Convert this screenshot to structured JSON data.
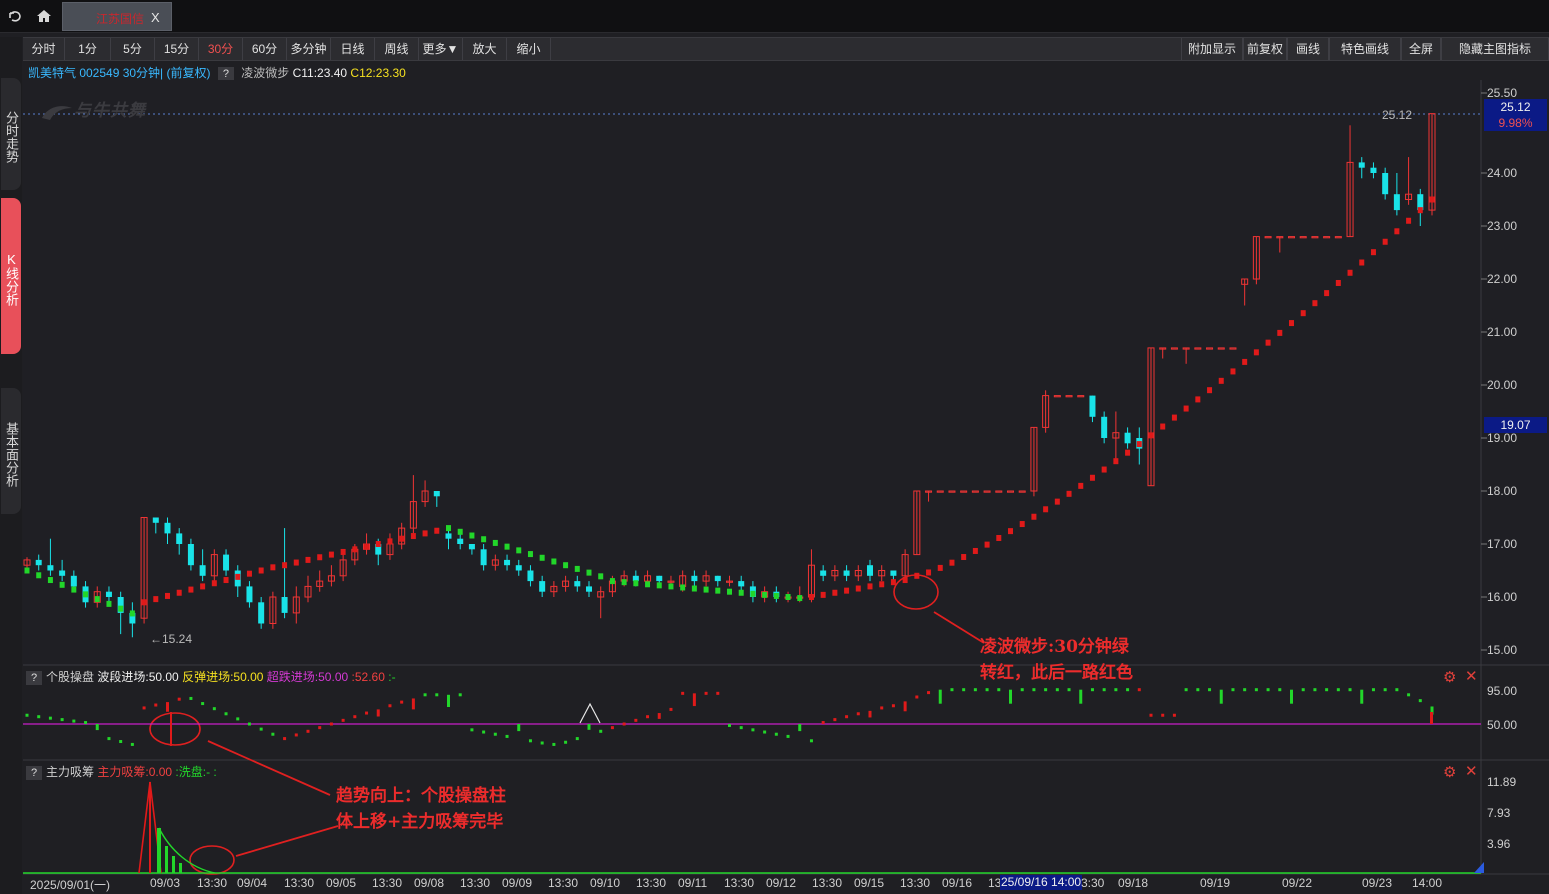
{
  "topbar": {
    "tab_title": "江苏国信",
    "tab_close": "X"
  },
  "side_tabs": [
    {
      "label": "分时走势",
      "active": false
    },
    {
      "label": "K线分析",
      "active": true
    },
    {
      "label": "基本面分析",
      "active": false
    }
  ],
  "periods": [
    "分时",
    "1分",
    "5分",
    "15分",
    "30分",
    "60分",
    "多分钟",
    "日线",
    "周线",
    "更多▼",
    "放大",
    "缩小"
  ],
  "active_period": "30分",
  "right_buttons": [
    "附加显示",
    "前复权",
    "画线",
    "特色画线",
    "全屏",
    "隐藏主图指标"
  ],
  "stock": {
    "name_code": "凯美特气 002549 30分钟|",
    "adj": "(前复权)",
    "help": "?",
    "indicator": "凌波微步",
    "c1": "C11:23.40",
    "c2": "C12:23.30"
  },
  "watermark": "与牛共舞",
  "main_axis": {
    "ticks": [
      "25.50",
      "24.00",
      "23.00",
      "22.00",
      "21.00",
      "20.00",
      "19.00",
      "18.00",
      "17.00",
      "16.00",
      "15.00"
    ],
    "pill_price": "25.12",
    "pill_pct": "9.98%",
    "pill_19": "19.07",
    "high_label": "25.12",
    "low_label": "15.24"
  },
  "annotations": {
    "a1_l1": "凌波微步:30分钟绿",
    "a1_l2": "转红，此后一路红色",
    "a2_l1": "趋势向上：个股操盘柱",
    "a2_l2": "体上移+主力吸筹完毕"
  },
  "panel1": {
    "help": "?",
    "name": "个股操盘",
    "f1": "波段进场:50.00",
    "f2": "反弹进场:50.00",
    "f3": "超跌进场:50.00",
    "f4": ":52.60",
    "f5": ":-",
    "ticks": [
      "95.00",
      "50.00"
    ]
  },
  "panel2": {
    "help": "?",
    "name": "主力吸筹",
    "f1": "主力吸筹:0.00",
    "f2": ":洗盘:-",
    "f3": ":",
    "ticks": [
      "11.89",
      "7.93",
      "3.96"
    ]
  },
  "x_axis": {
    "labels": [
      "2025/09/01(一)",
      "09/03",
      "13:30",
      "09/04",
      "13:30",
      "09/05",
      "13:30",
      "09/08",
      "13:30",
      "09/09",
      "13:30",
      "09/10",
      "13:30",
      "09/11",
      "13:30",
      "09/12",
      "13:30",
      "09/15",
      "13:30",
      "09/16",
      "13",
      "09/18",
      "09/19",
      "09/22",
      "09/23",
      "14:00"
    ],
    "cursor_label": "25/09/16 14:00",
    "cursor_tail": "3:30"
  },
  "colors": {
    "up": "#f03434",
    "down": "#19e3e8",
    "green": "#22d62a",
    "magenta": "#c81fc8",
    "pill": "#0b1a86"
  },
  "icons": [
    "back-icon",
    "home-icon",
    "gear-icon",
    "close-icon",
    "help-icon"
  ]
}
